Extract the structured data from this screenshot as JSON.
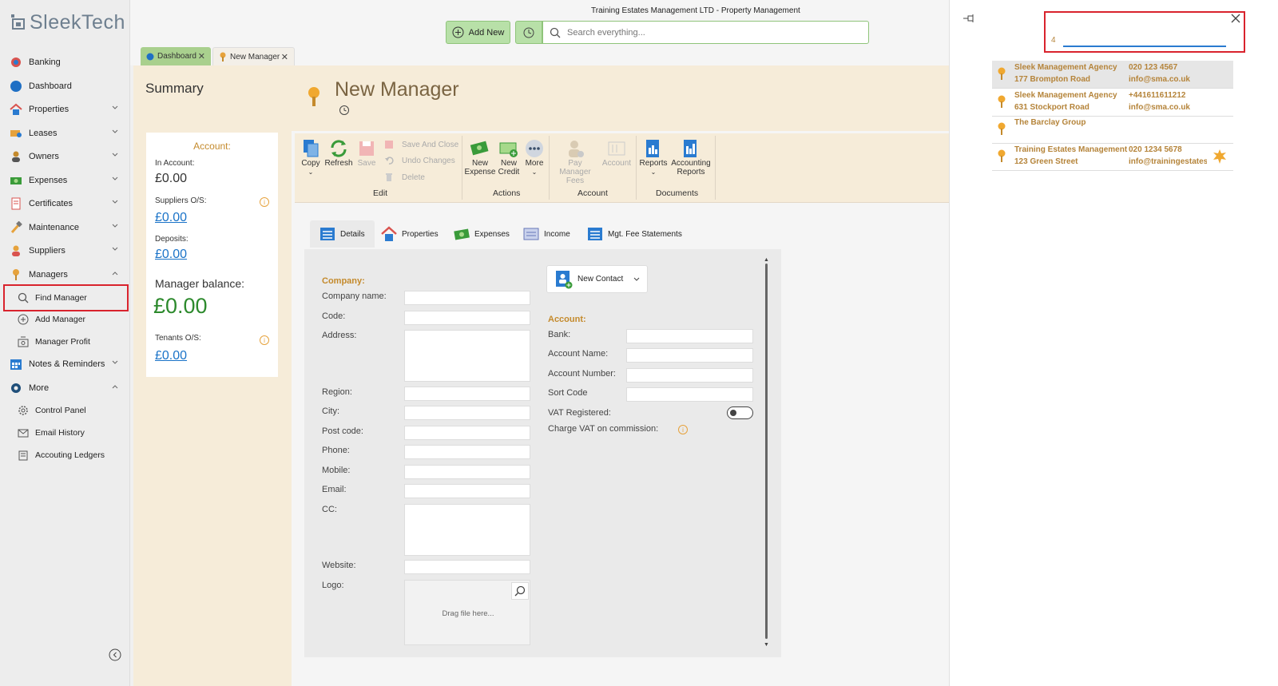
{
  "app": {
    "logo": "SleekTech",
    "window_title": "Training Estates Management LTD - Property Management"
  },
  "sidebar": {
    "items": [
      {
        "label": "Banking"
      },
      {
        "label": "Dashboard"
      },
      {
        "label": "Properties"
      },
      {
        "label": "Leases"
      },
      {
        "label": "Owners"
      },
      {
        "label": "Expenses"
      },
      {
        "label": "Certificates"
      },
      {
        "label": "Maintenance"
      },
      {
        "label": "Suppliers"
      },
      {
        "label": "Managers"
      },
      {
        "label": "Notes & Reminders"
      },
      {
        "label": "More"
      }
    ],
    "managers_sub": [
      {
        "label": "Find Manager"
      },
      {
        "label": "Add Manager"
      },
      {
        "label": "Manager Profit"
      }
    ],
    "more_sub": [
      {
        "label": "Control Panel"
      },
      {
        "label": "Email History"
      },
      {
        "label": "Accouting Ledgers"
      }
    ]
  },
  "toolbar": {
    "add_new": "Add New",
    "search_placeholder": "Search everything..."
  },
  "tabs": [
    {
      "label": "Dashboard"
    },
    {
      "label": "New Manager"
    }
  ],
  "summary": {
    "title": "Summary",
    "account_heading": "Account:",
    "in_account_label": "In Account:",
    "in_account_value": "£0.00",
    "suppliers_label": "Suppliers O/S:",
    "suppliers_value": "£0.00",
    "deposits_label": "Deposits:",
    "deposits_value": "£0.00",
    "balance_label": "Manager balance:",
    "balance_value": "£0.00",
    "tenants_label": "Tenants O/S:",
    "tenants_value": "£0.00"
  },
  "page": {
    "title": "New Manager"
  },
  "ribbon": {
    "copy": "Copy",
    "refresh": "Refresh",
    "save": "Save",
    "save_and_close": "Save And Close",
    "undo_changes": "Undo Changes",
    "delete": "Delete",
    "edit_group": "Edit",
    "new_expense_1": "New",
    "new_expense_2": "Expense",
    "new_credit_1": "New",
    "new_credit_2": "Credit",
    "more": "More",
    "actions_group": "Actions",
    "pay_fees_1": "Pay Manager",
    "pay_fees_2": "Fees",
    "account": "Account",
    "account_group": "Account",
    "reports": "Reports",
    "acc_reports_1": "Accounting",
    "acc_reports_2": "Reports",
    "documents_group": "Documents"
  },
  "form_tabs": [
    {
      "label": "Details"
    },
    {
      "label": "Properties"
    },
    {
      "label": "Expenses"
    },
    {
      "label": "Income"
    },
    {
      "label": "Mgt. Fee Statements"
    }
  ],
  "form": {
    "company_heading": "Company:",
    "company_name": "Company name:",
    "code": "Code:",
    "address": "Address:",
    "region": "Region:",
    "city": "City:",
    "post_code": "Post code:",
    "phone": "Phone:",
    "mobile": "Mobile:",
    "email": "Email:",
    "cc": "CC:",
    "website": "Website:",
    "logo": "Logo:",
    "drag_file": "Drag file here...",
    "new_contact": "New Contact",
    "account_heading": "Account:",
    "bank": "Bank:",
    "account_name": "Account Name:",
    "account_number": "Account Number:",
    "sort_code": "Sort Code",
    "vat_registered": "VAT Registered:",
    "charge_vat": "Charge VAT on commission:"
  },
  "search_panel": {
    "count": "4",
    "query": "",
    "results": [
      {
        "name": "Sleek Management Agency",
        "address": "177 Brompton Road",
        "phone": "020 123 4567",
        "email": "info@sma.co.uk"
      },
      {
        "name": "Sleek Management Agency",
        "address": "631 Stockport Road",
        "phone": "+441611611212",
        "email": "info@sma.co.uk"
      },
      {
        "name": "The Barclay Group",
        "address": "",
        "phone": "",
        "email": ""
      },
      {
        "name": "Training Estates Management",
        "address": "123 Green Street",
        "phone": "020 1234 5678",
        "email": "info@trainingestates.co.uk"
      }
    ]
  }
}
